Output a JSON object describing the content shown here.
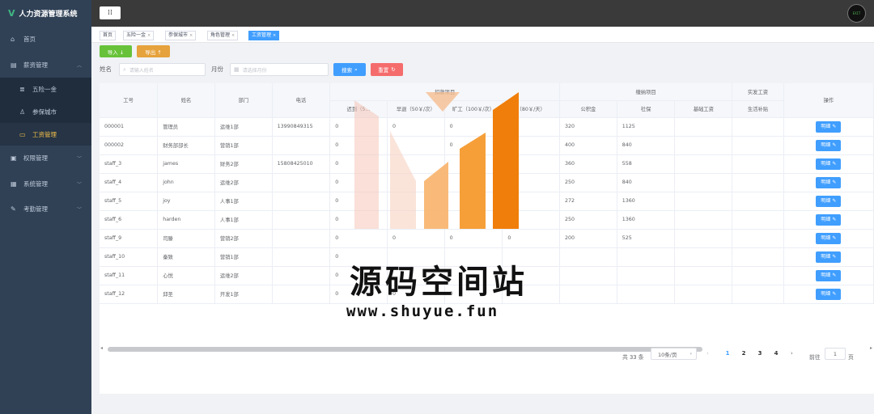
{
  "app": {
    "title": "人力资源管理系统",
    "logo_glyph": "V"
  },
  "sidebar": {
    "items": [
      {
        "label": "首页",
        "icon": "home-icon"
      },
      {
        "label": "薪资管理",
        "icon": "chart-icon"
      },
      {
        "label": "五险一金",
        "icon": "layers-icon"
      },
      {
        "label": "参保城市",
        "icon": "user-icon"
      },
      {
        "label": "工资管理",
        "icon": "money-icon"
      },
      {
        "label": "权限管理",
        "icon": "lock-icon"
      },
      {
        "label": "系统管理",
        "icon": "settings-icon"
      },
      {
        "label": "考勤管理",
        "icon": "edit-icon"
      }
    ]
  },
  "topbar": {
    "menu_glyph": "⁞⁞",
    "avatar_text": "EXIT"
  },
  "tags": [
    {
      "label": "首页"
    },
    {
      "label": "五险一金"
    },
    {
      "label": "参保城市"
    },
    {
      "label": "角色管理"
    },
    {
      "label": "工资管理"
    }
  ],
  "toolbar": {
    "import_label": "导入 ↓",
    "export_label": "导出 ↑"
  },
  "filters": {
    "name_label": "姓名",
    "name_placeholder": "请输入姓名",
    "month_label": "月份",
    "month_placeholder": "请选择月份",
    "search_label": "搜索",
    "reset_label": "重置"
  },
  "table": {
    "group_headers": {
      "attendance": "扣款项目",
      "benefits": "缴纳项目",
      "actual": "实发工资"
    },
    "headers": {
      "id": "工号",
      "name": "姓名",
      "dept": "部门",
      "phone": "电话",
      "late": "迟到（5…",
      "early": "早退（50￥/次）",
      "absent": "旷工（100￥/次）",
      "leave": "（80￥/天）",
      "fund": "公积金",
      "insurance": "社保",
      "base": "基础工资",
      "subsidy": "生活补贴",
      "op": "操作"
    },
    "detail_label": "明细",
    "rows": [
      {
        "id": "000001",
        "name": "管理员",
        "dept": "运维1部",
        "phone": "13990849315",
        "late": "0",
        "early": "0",
        "absent": "0",
        "leave": "",
        "fund": "320",
        "insurance": "1125"
      },
      {
        "id": "000002",
        "name": "财务部部长",
        "dept": "营销1部",
        "phone": "",
        "late": "0",
        "early": "",
        "absent": "0",
        "leave": "",
        "fund": "400",
        "insurance": "840"
      },
      {
        "id": "staff_3",
        "name": "james",
        "dept": "财务2部",
        "phone": "15808425010",
        "late": "0",
        "early": "",
        "absent": "",
        "leave": "",
        "fund": "360",
        "insurance": "558"
      },
      {
        "id": "staff_4",
        "name": "john",
        "dept": "运维2部",
        "phone": "",
        "late": "0",
        "early": "",
        "absent": "",
        "leave": "",
        "fund": "250",
        "insurance": "840"
      },
      {
        "id": "staff_5",
        "name": "joy",
        "dept": "人事1部",
        "phone": "",
        "late": "0",
        "early": "",
        "absent": "",
        "leave": "",
        "fund": "272",
        "insurance": "1360"
      },
      {
        "id": "staff_6",
        "name": "harden",
        "dept": "人事1部",
        "phone": "",
        "late": "0",
        "early": "",
        "absent": "",
        "leave": "",
        "fund": "250",
        "insurance": "1360"
      },
      {
        "id": "staff_9",
        "name": "司滕",
        "dept": "营销2部",
        "phone": "",
        "late": "0",
        "early": "0",
        "absent": "0",
        "leave": "0",
        "fund": "200",
        "insurance": "525"
      },
      {
        "id": "staff_10",
        "name": "秦致",
        "dept": "营销1部",
        "phone": "",
        "late": "0",
        "early": "",
        "absent": "",
        "leave": "",
        "fund": "",
        "insurance": ""
      },
      {
        "id": "staff_11",
        "name": "心悦",
        "dept": "运维2部",
        "phone": "",
        "late": "0",
        "early": "",
        "absent": "",
        "leave": "",
        "fund": "",
        "insurance": ""
      },
      {
        "id": "staff_12",
        "name": "邱圣",
        "dept": "开发1部",
        "phone": "",
        "late": "0",
        "early": "0",
        "absent": "0",
        "leave": "",
        "fund": "",
        "insurance": ""
      }
    ]
  },
  "pagination": {
    "total_text": "共 33 条",
    "page_size": "10条/页",
    "pages": [
      "1",
      "2",
      "3",
      "4"
    ],
    "current_page": "1",
    "goto_label": "前往",
    "goto_value": "1",
    "goto_suffix": "页"
  },
  "watermark": {
    "title": "源码空间站",
    "url": "www.shuyue.fun"
  },
  "colors": {
    "sidebar_bg": "#304156",
    "primary": "#409eff",
    "success": "#67c23a",
    "warning": "#e6a23c",
    "danger": "#f56c6c",
    "active_menu": "#f4c049"
  }
}
